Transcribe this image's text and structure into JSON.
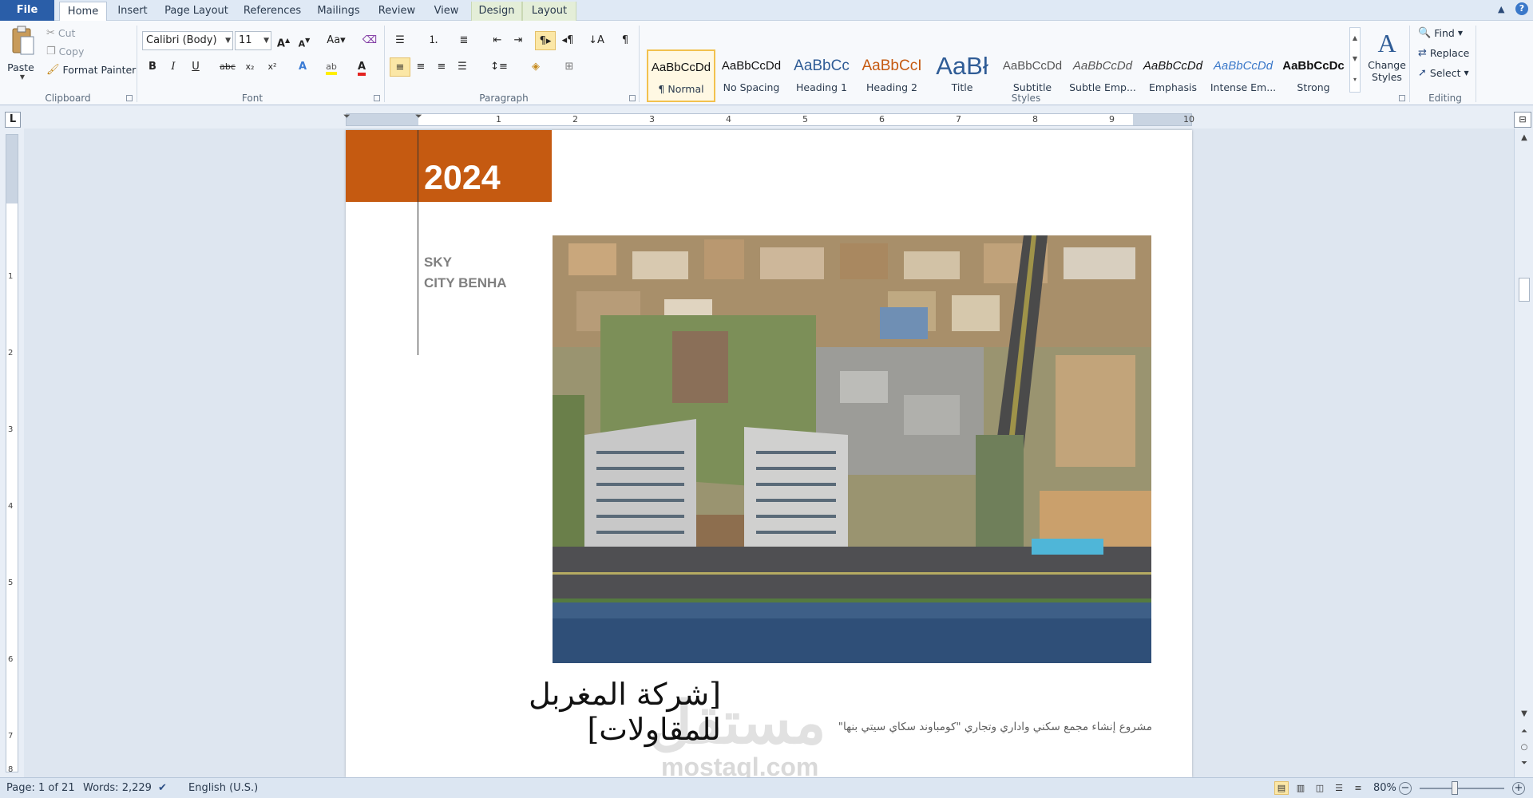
{
  "tabs": [
    "File",
    "Home",
    "Insert",
    "Page Layout",
    "References",
    "Mailings",
    "Review",
    "View",
    "Design",
    "Layout"
  ],
  "clipboard": {
    "paste": "Paste",
    "cut": "Cut",
    "copy": "Copy",
    "format_painter": "Format Painter",
    "label": "Clipboard"
  },
  "font": {
    "name": "Calibri (Body)",
    "size": "11",
    "label": "Font"
  },
  "paragraph": {
    "label": "Paragraph"
  },
  "styles": {
    "label": "Styles",
    "items": [
      {
        "preview": "AaBbCcDd",
        "name": "¶ Normal"
      },
      {
        "preview": "AaBbCcDd",
        "name": "No Spacing"
      },
      {
        "preview": "AaBbCc",
        "name": "Heading 1"
      },
      {
        "preview": "AaBbCcI",
        "name": "Heading 2"
      },
      {
        "preview": "AaBł",
        "name": "Title"
      },
      {
        "preview": "AaBbCcDd",
        "name": "Subtitle"
      },
      {
        "preview": "AaBbCcDd",
        "name": "Subtle Emp..."
      },
      {
        "preview": "AaBbCcDd",
        "name": "Emphasis"
      },
      {
        "preview": "AaBbCcDd",
        "name": "Intense Em..."
      },
      {
        "preview": "AaBbCcDc",
        "name": "Strong"
      }
    ],
    "change_styles_line1": "Change",
    "change_styles_line2": "Styles"
  },
  "editing": {
    "find": "Find",
    "replace": "Replace",
    "select": "Select",
    "label": "Editing"
  },
  "ruler": [
    "1",
    "2",
    "3",
    "4",
    "5",
    "6",
    "7",
    "8",
    "9",
    "10"
  ],
  "vruler": [
    "1",
    "2",
    "3",
    "4",
    "5",
    "6",
    "7",
    "8"
  ],
  "document": {
    "year": "2024",
    "sky_line1": "SKY",
    "sky_line2": "CITY BENHA",
    "company": "[شركة المغربل للمقاولات]",
    "subtitle": "مشروع إنشاء مجمع سكني واداري وتجاري \"كومباوند سكاي سيتي بنها\"",
    "watermark_ar": "مستقل",
    "watermark_en": "mostaql.com"
  },
  "status": {
    "page": "Page: 1 of 21",
    "words": "Words: 2,229",
    "language": "English (U.S.)",
    "zoom": "80%"
  }
}
